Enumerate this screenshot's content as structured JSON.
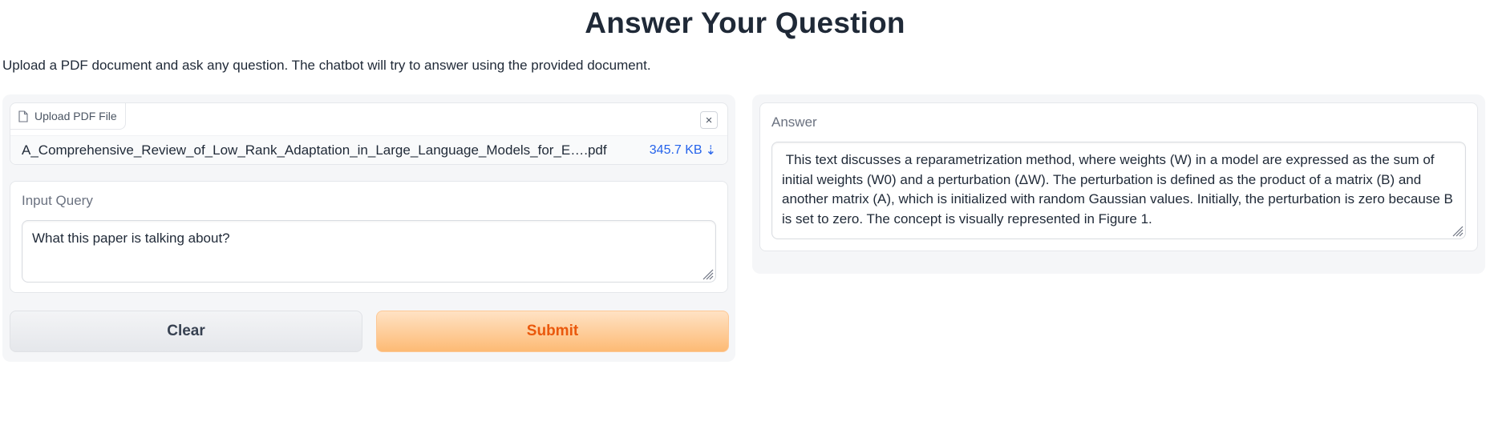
{
  "header": {
    "title": "Answer Your Question",
    "description": "Upload a PDF document and ask any question. The chatbot will try to answer using the provided document."
  },
  "file_upload": {
    "label": "Upload PDF File",
    "close_symbol": "×",
    "file_name": "A_Comprehensive_Review_of_Low_Rank_Adaptation_in_Large_Language_Models_for_E….pdf",
    "file_size": "345.7 KB",
    "download_symbol": "⇣",
    "file_icon": "file-icon"
  },
  "query": {
    "label": "Input Query",
    "value": "What this paper is talking about?"
  },
  "buttons": {
    "clear": "Clear",
    "submit": "Submit"
  },
  "answer": {
    "label": "Answer",
    "value": " This text discusses a reparametrization method, where weights (W) in a model are expressed as the sum of initial weights (W0) and a perturbation (ΔW). The perturbation is defined as the product of a matrix (B) and another matrix (A), which is initialized with random Gaussian values. Initially, the perturbation is zero because B is set to zero. The concept is visually represented in Figure 1."
  },
  "colors": {
    "accent_orange": "#ea580c",
    "link_blue": "#2563eb",
    "panel_bg": "#f5f6f8"
  }
}
